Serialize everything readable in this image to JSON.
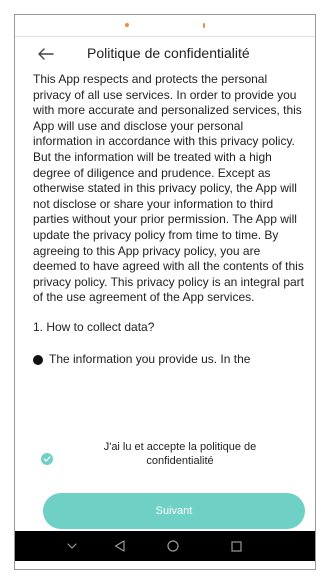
{
  "colors": {
    "accent": "#6fd0c5",
    "status_orange": "#f28b3a",
    "nav_background": "#000000",
    "nav_icon": "#9a9a9a"
  },
  "icons": {
    "back": "arrow-left-icon",
    "checkbox": "check-circle-icon",
    "nav": [
      "chevron-down-icon",
      "triangle-back-icon",
      "circle-home-icon",
      "square-recents-icon"
    ]
  },
  "header": {
    "title": "Politique de confidentialité"
  },
  "policy": {
    "body": "This App respects and protects the personal privacy of all use services. In order to provide you with more accurate and personalized services, this App will use and disclose your personal information in accordance with this privacy policy. But the information will be treated with a high degree of diligence and prudence. Except as otherwise stated in this privacy policy, the App will not disclose or share your information to third parties without your prior permission. The App will update the privacy policy from time to time. By agreeing to this App privacy policy, you are deemed to have agreed with all the contents of this privacy policy. This privacy policy is an integral part of the use agreement of the App services.",
    "section_1": "1. How to collect data?",
    "bullet_1": "The information you provide us. In the"
  },
  "consent": {
    "label": "J'ai lu et accepte la politique de confidentialité",
    "checked": true
  },
  "actions": {
    "next_label": "Suivant"
  }
}
